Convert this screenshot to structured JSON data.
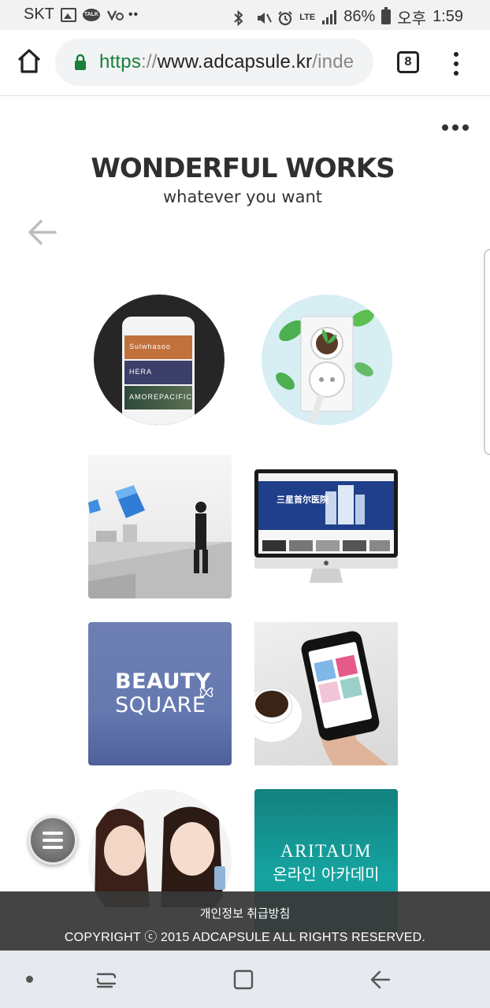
{
  "status_bar": {
    "carrier": "SKT",
    "kakao_badge": "TALK",
    "battery": "86%",
    "ampm": "오후",
    "time": "1:59",
    "network": "LTE",
    "icons": [
      "image-icon",
      "kakaotalk-icon",
      "voicemail-icon",
      "more-dots-icon",
      "bluetooth-icon",
      "mute-icon",
      "alarm-icon",
      "lte-icon",
      "signal-icon",
      "battery-icon"
    ]
  },
  "browser": {
    "url_scheme": "https",
    "url_separator": "://",
    "url_host": "www.adcapsule.kr",
    "url_path": "/inde",
    "tab_count": "8",
    "colors": {
      "secure": "#188038",
      "address_bg": "#f1f3f4"
    }
  },
  "page": {
    "title": "WONDERFUL WORKS",
    "subtitle": "whatever you want",
    "works": [
      {
        "name": "cosmetics-app-mockup",
        "labels": [
          "Sulwhasoo",
          "HERA",
          "AMOREPACIFIC"
        ]
      },
      {
        "name": "eco-power-outlet"
      },
      {
        "name": "businessman-cubes"
      },
      {
        "name": "hospital-website-imac",
        "label": "三星首尔医院"
      },
      {
        "name": "beauty-square",
        "line1": "BEAUTY",
        "line2": "SQUARE"
      },
      {
        "name": "coffee-smartphone"
      },
      {
        "name": "cosmetics-models"
      },
      {
        "name": "aritaum-academy",
        "line1": "ARITAUM",
        "line2": "온라인 아카데미"
      }
    ]
  },
  "footer": {
    "privacy_link": "개인정보 취급방침",
    "copyright": "COPYRIGHT ⓒ 2015 ADCAPSULE ALL RIGHTS RESERVED."
  },
  "colors": {
    "footer_bg": "#383838",
    "beauty_square": "#6679b0",
    "aritaum": "#15a3a0",
    "navbar": "#e7e9f0"
  }
}
